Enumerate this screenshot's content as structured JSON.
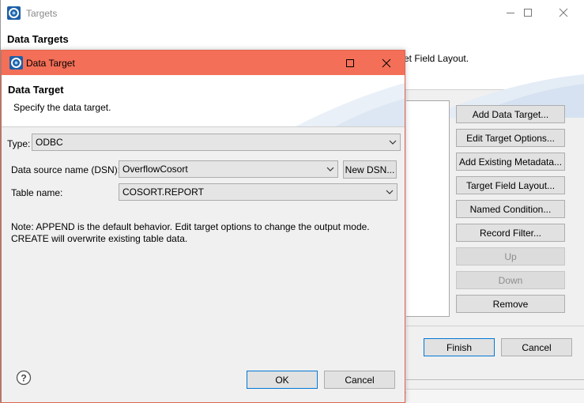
{
  "background_window": {
    "title": "Targets",
    "header_title": "Data Targets",
    "header_desc": "et Field Layout.",
    "side_buttons": [
      {
        "label": "Add Data Target...",
        "enabled": true
      },
      {
        "label": "Edit Target Options...",
        "enabled": true
      },
      {
        "label": "Add Existing Metadata...",
        "enabled": true
      },
      {
        "label": "Target Field Layout...",
        "enabled": true
      },
      {
        "label": "Named Condition...",
        "enabled": true
      },
      {
        "label": "Record Filter...",
        "enabled": true
      },
      {
        "label": "Up",
        "enabled": false
      },
      {
        "label": "Down",
        "enabled": false
      },
      {
        "label": "Remove",
        "enabled": true
      }
    ],
    "finish_label": "Finish",
    "cancel_label": "Cancel"
  },
  "dialog": {
    "title": "Data Target",
    "header_title": "Data Target",
    "header_desc": "Specify the data target.",
    "type_label": "Type:",
    "type_value": "ODBC",
    "dsn_label": "Data source name (DSN):",
    "dsn_value": "OverflowCosort",
    "new_dsn_label": "New DSN...",
    "table_label": "Table name:",
    "table_value": "COSORT.REPORT",
    "note_line1": "Note: APPEND is the default behavior. Edit target options to change the output mode.",
    "note_line2": "CREATE will overwrite existing table data.",
    "ok_label": "OK",
    "cancel_label": "Cancel"
  },
  "colors": {
    "dialog_titlebar": "#f46f57",
    "default_button_border": "#0078d7"
  },
  "icons": {
    "app": "cosort-app-icon",
    "help": "help-icon",
    "minimize": "minimize-icon",
    "maximize": "maximize-icon",
    "close": "close-icon",
    "dropdown": "chevron-down-icon"
  }
}
